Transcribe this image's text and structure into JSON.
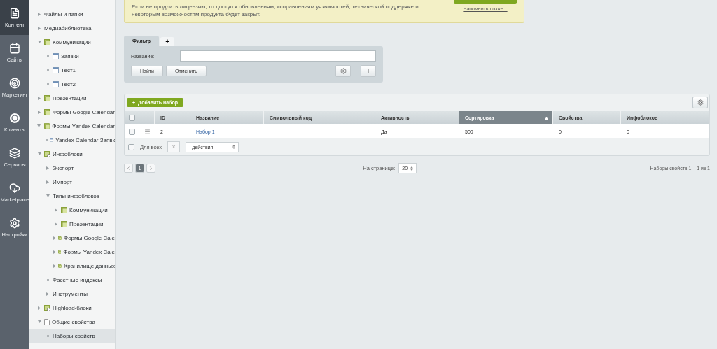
{
  "menu": [
    {
      "label": "Контент",
      "kind": "content",
      "selected": true
    },
    {
      "label": "Сайты",
      "kind": "calendar",
      "selected": false
    },
    {
      "label": "Маркетинг",
      "kind": "target",
      "selected": false
    },
    {
      "label": "Клиенты",
      "kind": "clients",
      "selected": false
    },
    {
      "label": "Сервисы",
      "kind": "layers",
      "selected": false
    },
    {
      "label": "Marketplace",
      "kind": "cloud",
      "selected": false
    },
    {
      "label": "Настройки",
      "kind": "gear",
      "selected": false
    }
  ],
  "tree": [
    {
      "label": "Файлы и папки",
      "expanded": false,
      "selected": false
    },
    {
      "label": "Медиабиблиотека",
      "expanded": false,
      "selected": false
    },
    {
      "label": "Коммуникации",
      "kind": "folder",
      "expanded": true,
      "selected": false,
      "children": [
        {
          "label": "Заявки",
          "kind": "table",
          "selected": false
        },
        {
          "label": "Тест1",
          "kind": "table",
          "selected": false
        },
        {
          "label": "Тест2",
          "kind": "table",
          "selected": false
        }
      ]
    },
    {
      "label": "Презентации",
      "kind": "folder",
      "expanded": false,
      "selected": false
    },
    {
      "label": "Формы Google Calendar",
      "kind": "folder",
      "expanded": false,
      "selected": false
    },
    {
      "label": "Формы Yandex Calendar",
      "kind": "folder",
      "expanded": true,
      "selected": false,
      "children": [
        {
          "label": "Yandex Calendar Заявк",
          "kind": "table",
          "selected": false
        }
      ]
    },
    {
      "label": "Инфоблоки",
      "kind": "gearfolder",
      "expanded": true,
      "selected": false,
      "children": [
        {
          "label": "Экспорт",
          "expanded": false,
          "selected": false
        },
        {
          "label": "Импорт",
          "expanded": false,
          "selected": false
        },
        {
          "label": "Типы инфоблоков",
          "expanded": true,
          "selected": false,
          "children": [
            {
              "label": "Коммуникации",
              "kind": "folder",
              "expanded": false,
              "selected": false
            },
            {
              "label": "Презентации",
              "kind": "folder",
              "expanded": false,
              "selected": false
            },
            {
              "label": "Формы Google Cale",
              "kind": "folder",
              "expanded": false,
              "selected": false
            },
            {
              "label": "Формы Yandex Cale",
              "kind": "folder",
              "expanded": false,
              "selected": false
            },
            {
              "label": "Хранилище данных",
              "kind": "folder",
              "expanded": false,
              "selected": false
            }
          ]
        },
        {
          "label": "Фасетные индексы",
          "selected": false
        },
        {
          "label": "Инструменты",
          "expanded": false,
          "selected": false
        }
      ]
    },
    {
      "label": "Highload-блоки",
      "kind": "gearfolder",
      "expanded": false,
      "selected": false
    },
    {
      "label": "Общие свойства",
      "kind": "page",
      "expanded": true,
      "selected": false,
      "children": [
        {
          "label": "Наборы свойств",
          "selected": true
        }
      ]
    }
  ],
  "banner": {
    "text": "Если не продлить лицензию, то доступ к обновлениям, исправлениям уязвимостей, технической поддержке и некоторым возможностям продукта будет закрыт.",
    "remind": "Напомнить позже..."
  },
  "filter": {
    "tabs": [
      {
        "label": "Фильтр",
        "selected": true
      }
    ],
    "add_tab": "+",
    "collapse": "–",
    "field_label": "Название:",
    "find": "Найти",
    "cancel": "Отменить",
    "add": "+"
  },
  "table": {
    "add_button": "Добавить набор",
    "add_icon": "+",
    "select_all_checked": false,
    "columns": [
      {
        "label": "ID",
        "sorted": false
      },
      {
        "label": "Название",
        "sorted": false
      },
      {
        "label": "Символьный код",
        "sorted": false
      },
      {
        "label": "Активность",
        "sorted": false
      },
      {
        "label": "Сортировка",
        "sorted": true
      },
      {
        "label": "Свойства",
        "sorted": false
      },
      {
        "label": "Инфоблоков",
        "sorted": false
      }
    ],
    "rows": [
      {
        "checked": false,
        "cells": [
          "2",
          "Набор 1",
          null,
          "Да",
          "500",
          "0",
          "0"
        ]
      }
    ],
    "footer": {
      "checked": false,
      "all_label": "Для всех",
      "delete": "×",
      "action": "- действия -"
    }
  },
  "pagination": {
    "pages": [
      {
        "label": "1",
        "selected": true
      }
    ],
    "per_page_label": "На странице:",
    "per_page": "20",
    "summary": "Наборы свойств 1 – 1 из 1"
  }
}
